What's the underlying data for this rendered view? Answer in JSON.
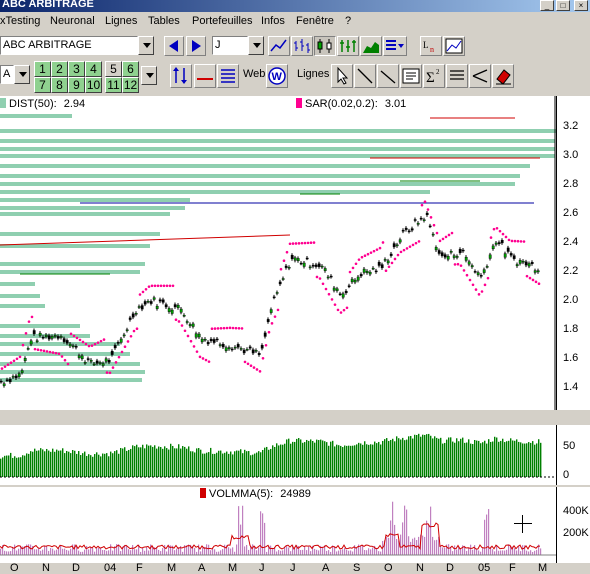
{
  "window": {
    "title": "ABC ARBITRAGE"
  },
  "menu": {
    "items": [
      "xTesting",
      "Neuronal",
      "Lignes",
      "Tables",
      "Portefeuilles",
      "Infos",
      "Fenêtre",
      "?"
    ]
  },
  "toolbar": {
    "symbol": "ABC ARBITRAGE",
    "period": "J",
    "mode": "A",
    "number_buttons": [
      "1",
      "2",
      "3",
      "4",
      "5",
      "6",
      "7",
      "8",
      "9",
      "10",
      "11",
      "12"
    ],
    "selected_number": "5",
    "web_label": "Web",
    "lines_label": "Lignes"
  },
  "indicators": {
    "dist_label": "DIST(50):",
    "dist_value": "2.94",
    "sar_label": "SAR(0.02,0.2):",
    "sar_value": "3.01",
    "volmma_label": "VOLMMA(5):",
    "volmma_value": "24989"
  },
  "price_axis": [
    "3.2",
    "3.0",
    "2.8",
    "2.6",
    "2.4",
    "2.2",
    "2.0",
    "1.8",
    "1.6",
    "1.4"
  ],
  "osc_axis": [
    "50",
    "0"
  ],
  "vol_axis": [
    "400K",
    "200K"
  ],
  "months": [
    "O",
    "N",
    "D",
    "04",
    "F",
    "M",
    "A",
    "M",
    "J",
    "J",
    "A",
    "S",
    "O",
    "N",
    "D",
    "05",
    "F",
    "M"
  ],
  "colors": {
    "candle_up": "#00a000",
    "sar": "#ff0090",
    "volume_bars": "#008000",
    "dist_bars": "#8fcfb0",
    "vol_line": "#d00000",
    "vol_bars": "#c080c0"
  }
}
